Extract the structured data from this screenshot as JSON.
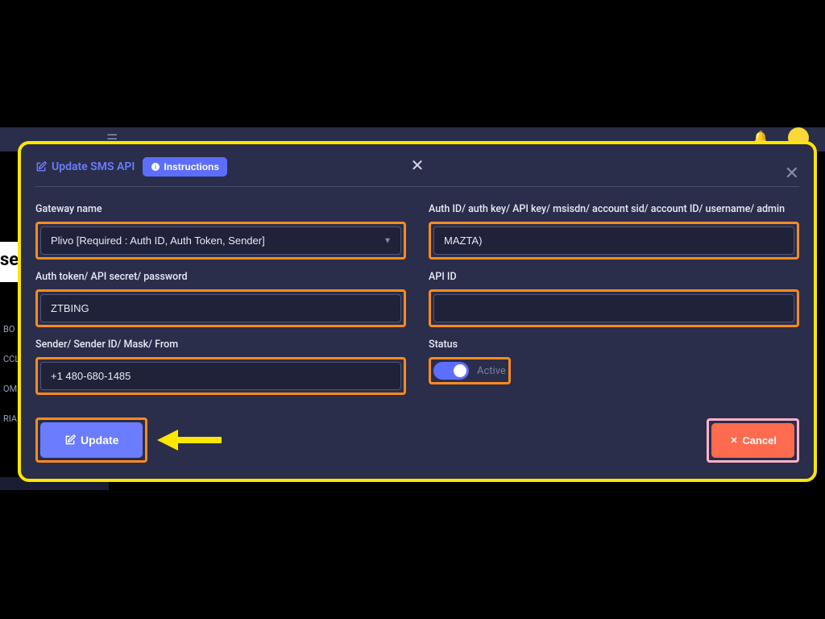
{
  "modal": {
    "title": "Update SMS API",
    "instructions_label": "Instructions"
  },
  "fields": {
    "gateway": {
      "label": "Gateway name",
      "value": "Plivo [Required : Auth ID, Auth Token, Sender]"
    },
    "auth_id": {
      "label": "Auth ID/ auth key/ API key/ msisdn/ account sid/ account ID/ username/ admin",
      "value": "MAZTA)"
    },
    "auth_token": {
      "label": "Auth token/ API secret/ password",
      "value": "ZTBING"
    },
    "api_id": {
      "label": "API ID",
      "value": ""
    },
    "sender": {
      "label": "Sender/ Sender ID/ Mask/ From",
      "value": "+1 480-680-1485"
    },
    "status": {
      "label": "Status",
      "state": "Active"
    }
  },
  "buttons": {
    "update": "Update",
    "cancel": "Cancel"
  },
  "sidebar_fragments": [
    "BO",
    "CCL",
    "OM",
    "RIA"
  ]
}
